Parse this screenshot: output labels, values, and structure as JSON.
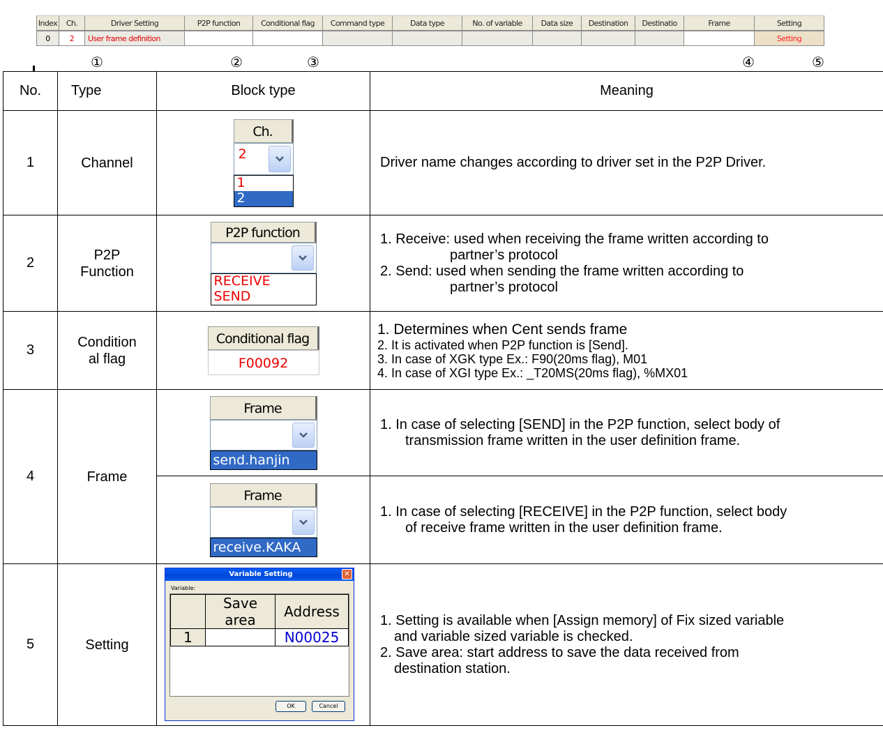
{
  "top_grid": {
    "headers": [
      "Index",
      "Ch.",
      "Driver Setting",
      "P2P function",
      "Conditional flag",
      "Command type",
      "Data type",
      "No. of variable",
      "Data size",
      "Destination",
      "Destinatio",
      "Frame",
      "Setting"
    ],
    "row": {
      "index": "0",
      "ch": "2",
      "driver_setting": "User frame definition",
      "p2p_function": "",
      "conditional_flag": "",
      "frame": "",
      "setting": "Setting"
    },
    "markers": [
      "①",
      "②",
      "③",
      "④",
      "⑤"
    ]
  },
  "table": {
    "headers": {
      "no": "No.",
      "type": "Type",
      "block_type": "Block type",
      "meaning": "Meaning"
    },
    "rows": [
      {
        "no": "1",
        "type": "Channel",
        "widget": {
          "header": "Ch.",
          "value": "2",
          "list": [
            "1",
            "2"
          ]
        },
        "meaning": "Driver name changes according to driver set in the P2P Driver."
      },
      {
        "no": "2",
        "type_line1": "P2P",
        "type_line2": "Function",
        "widget": {
          "header": "P2P function",
          "value": "",
          "list": [
            "RECEIVE",
            "SEND"
          ]
        },
        "meaning": [
          {
            "lead": "1. Receive: used when receiving the frame written according to",
            "cont": "partner’s protocol"
          },
          {
            "lead": "2.  Send:  used  when  sending  the  frame  written  according  to",
            "cont": "partner’s protocol"
          }
        ]
      },
      {
        "no": "3",
        "type_line1": "Condition",
        "type_line2": "al flag",
        "widget": {
          "header": "Conditional flag",
          "value": "F00092"
        },
        "meaning": [
          "1. Determines when Cent sends frame",
          "2. It is activated when P2P function is [Send].",
          "3. In case of XGK type Ex.: F90(20ms flag), M01",
          "4. In case of XGI type Ex.: _T20MS(20ms flag), %MX01"
        ]
      },
      {
        "no": "4",
        "type": "Frame",
        "widget_a": {
          "header": "Frame",
          "selected": "send.hanjin"
        },
        "meaning_a": {
          "lead": "1. In case of selecting [SEND] in the P2P function, select body of",
          "cont": "transmission frame written in the user definition frame."
        },
        "widget_b": {
          "header": "Frame",
          "selected": "receive.KAKA"
        },
        "meaning_b": {
          "lead": "1. In case of selecting [RECEIVE] in the P2P function, select body",
          "cont": "of receive frame written in the user definition frame."
        }
      },
      {
        "no": "5",
        "type": "Setting",
        "dialog": {
          "title": "Variable Setting",
          "variable_label": "Variable:",
          "col_save": "Save area",
          "col_address": "Address",
          "row_index": "1",
          "row_address": "N00025",
          "ok": "OK",
          "cancel": "Cancel"
        },
        "meaning": [
          {
            "lead": "1. Setting is available when [Assign memory] of Fix sized variable",
            "cont": "and variable sized variable is checked."
          },
          {
            "lead": "2.  Save  area:  start  address  to  save  the  data  received  from",
            "cont": "destination station."
          }
        ]
      }
    ]
  }
}
